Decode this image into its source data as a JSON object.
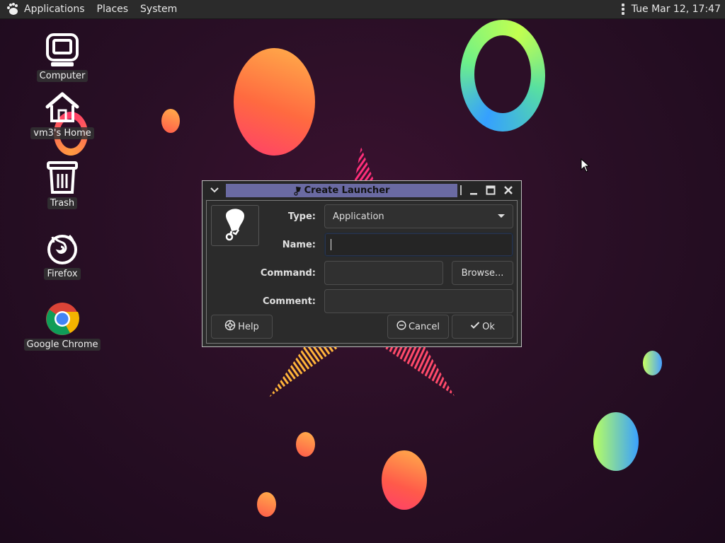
{
  "panel": {
    "menus": [
      "Applications",
      "Places",
      "System"
    ],
    "clock": "Tue Mar 12, 17:47"
  },
  "desktop": {
    "icons": [
      {
        "label": "Computer",
        "icon": "computer-icon"
      },
      {
        "label": "vm3's Home",
        "icon": "home-icon"
      },
      {
        "label": "Trash",
        "icon": "trash-icon"
      },
      {
        "label": "Firefox",
        "icon": "firefox-icon"
      },
      {
        "label": "Google Chrome",
        "icon": "chrome-icon"
      }
    ]
  },
  "dialog": {
    "title": "Create Launcher",
    "type_label": "Type:",
    "type_value": "Application",
    "name_label": "Name:",
    "name_value": "",
    "command_label": "Command:",
    "command_value": "",
    "browse_label": "Browse...",
    "comment_label": "Comment:",
    "comment_value": "",
    "help_label": "Help",
    "cancel_label": "Cancel",
    "ok_label": "Ok"
  },
  "colors": {
    "title_highlight": "#6a6aa2",
    "panel_bg": "#2b2b2b",
    "desktop_bg": "#2a0f26"
  }
}
